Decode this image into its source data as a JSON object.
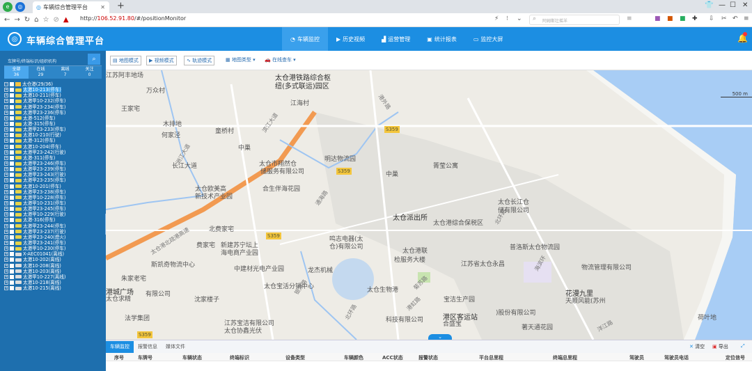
{
  "browser": {
    "tab_title": "车辆综合管理平台",
    "url_prefix": "http://",
    "url_host": "106.52.91.80",
    "url_path": "/#/positionMonitor",
    "search_placeholder": "阿姆斯壮摇羊"
  },
  "header": {
    "title": "车辆综合管理平台",
    "nav": [
      {
        "label": "车辆监控",
        "active": true
      },
      {
        "label": "历史视频"
      },
      {
        "label": "运营管理"
      },
      {
        "label": "统计报表"
      },
      {
        "label": "监控大屏"
      }
    ]
  },
  "sidebar": {
    "search_placeholder": "车牌号/终端标识/组织机构",
    "filters": [
      {
        "label": "全部",
        "count": "36",
        "active": true
      },
      {
        "label": "在线",
        "count": "29"
      },
      {
        "label": "离线",
        "count": "7"
      },
      {
        "label": "关注",
        "count": "0"
      }
    ],
    "root": "太仓港(29/36)",
    "vehicles": [
      {
        "label": "太港10-213(停车)",
        "selected": true
      },
      {
        "label": "太港10-211(停车)"
      },
      {
        "label": "太港甲10-232(停车)"
      },
      {
        "label": "太港甲23-234(停车)"
      },
      {
        "label": "太港甲23-236(停车)"
      },
      {
        "label": "太港-512(停车)"
      },
      {
        "label": "太港-315(停车)"
      },
      {
        "label": "太港甲23-233(停车)"
      },
      {
        "label": "太港10-210(行驶)"
      },
      {
        "label": "太港-312(停车)"
      },
      {
        "label": "太港10-204(停车)"
      },
      {
        "label": "太港甲23-242(行驶)"
      },
      {
        "label": "太港-311(停车)"
      },
      {
        "label": "太港甲23-246(停车)"
      },
      {
        "label": "太港甲23-239(停车)"
      },
      {
        "label": "太港甲23-243(行驶)"
      },
      {
        "label": "太港甲23-235(停车)"
      },
      {
        "label": "太港10-201(停车)"
      },
      {
        "label": "太港甲23-238(停车)"
      },
      {
        "label": "太港甲10-228(停车)"
      },
      {
        "label": "太港甲10-231(停车)"
      },
      {
        "label": "太港甲23-245(停车)"
      },
      {
        "label": "太港甲10-229(行驶)"
      },
      {
        "label": "太港-316(停车)"
      },
      {
        "label": "太港甲23-244(停车)"
      },
      {
        "label": "太港甲23-237(行驶)"
      },
      {
        "label": "太港甲23-240(熄火)"
      },
      {
        "label": "太港甲23-241(停车)"
      },
      {
        "label": "太港甲10-230(停车)"
      },
      {
        "label": "X-AEC01041(离线)",
        "offline": true
      },
      {
        "label": "太港10-202(离线)",
        "offline": true
      },
      {
        "label": "太港10-208(离线)",
        "offline": true
      },
      {
        "label": "太港10-203(离线)",
        "offline": true
      },
      {
        "label": "太港甲10-227(离线)",
        "offline": true
      },
      {
        "label": "太港10-218(离线)",
        "offline": true
      },
      {
        "label": "太港10-215(离线)",
        "offline": true
      }
    ]
  },
  "toolbar": {
    "map_mode": "地图模式",
    "video_mode": "视频模式",
    "track_mode": "轨迹模式",
    "map_type": "地图类型",
    "online_check": "在线查车"
  },
  "map": {
    "scale": "500 m",
    "labels": [
      "太仓港铁路综合枢",
      "纽(多式联运)园区",
      "万众村",
      "王家宅",
      "江海村",
      "木排地",
      "何家泾",
      "童桥村",
      "中巢",
      "长江大道",
      "太仓市翔然仓",
      "储服务有限公司",
      "明达物流园",
      "中巢",
      "箐莹公寓",
      "太仓欧美高",
      "新技术产业园",
      "合生伴海花园",
      "太仓派出所",
      "太仓港综合保税区",
      "太仓长江仓",
      "储有限公司",
      "北费家宅",
      "费家宅",
      "新建苏宁坛上",
      "海电商产业园",
      "鸣志电器(太",
      "仓)有限公司",
      "太仓港联",
      "检服务大楼",
      "普洛斯太仓物流园",
      "斯凯奇物流中心",
      "中建材光电产业园",
      "龙杰机械",
      "江苏省太仓永昌",
      "物流管理有限公司",
      "朱家老宅",
      "太仓宝活分销中心",
      "太仓生物港",
      "港城广场",
      "太仓求精",
      "有限公司",
      "沈家楼子",
      "宝洁生产园",
      "花漫九里",
      "天顺风能(苏州",
      ")股份有限公司",
      "法学集团",
      "江苏宝洁有限公司",
      "太仓协鑫光伏",
      "科技有限公司",
      "港区客运站",
      "合盛宝",
      "著天通花园",
      "荷叶地",
      "江苏阿丰地场"
    ],
    "roads": [
      "太仓港北疏港高速",
      "滨江大道",
      "洲江大道",
      "通海路",
      "港外路",
      "北环路",
      "银港路",
      "北环路",
      "洋江路",
      "港虹路",
      "菊苏路",
      "海滨环"
    ],
    "shields": [
      "S359",
      "S359",
      "S359",
      "S359"
    ]
  },
  "bottom": {
    "tabs": [
      {
        "label": "车辆监控",
        "active": true
      },
      {
        "label": "报警信息"
      },
      {
        "label": "媒体文件"
      }
    ],
    "clear": "清空",
    "export": "导出",
    "columns": [
      "序号",
      "车牌号",
      "车辆状态",
      "终端标识",
      "设备类型",
      "车辆颜色",
      "ACC状态",
      "报警状态",
      "平台总里程",
      "终端总里程",
      "驾驶员",
      "驾驶员电话",
      "定位信号"
    ]
  }
}
